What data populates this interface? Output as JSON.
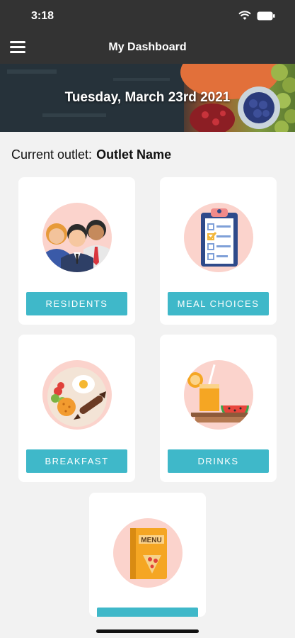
{
  "status_bar": {
    "time": "3:18"
  },
  "nav": {
    "title": "My Dashboard"
  },
  "banner": {
    "date": "Tuesday, March 23rd 2021"
  },
  "outlet": {
    "label": "Current outlet:",
    "name": "Outlet Name"
  },
  "cards": [
    {
      "label": "RESIDENTS",
      "icon": "residents-icon"
    },
    {
      "label": "MEAL CHOICES",
      "icon": "clipboard-checklist-icon"
    },
    {
      "label": "BREAKFAST",
      "icon": "breakfast-plate-icon"
    },
    {
      "label": "DRINKS",
      "icon": "drinks-tray-icon"
    },
    {
      "label": "",
      "icon": "menu-book-icon",
      "icon_text": "MENU"
    }
  ],
  "colors": {
    "accent": "#3fb8c9",
    "bar": "#333333",
    "circle": "#fbd3cc"
  }
}
